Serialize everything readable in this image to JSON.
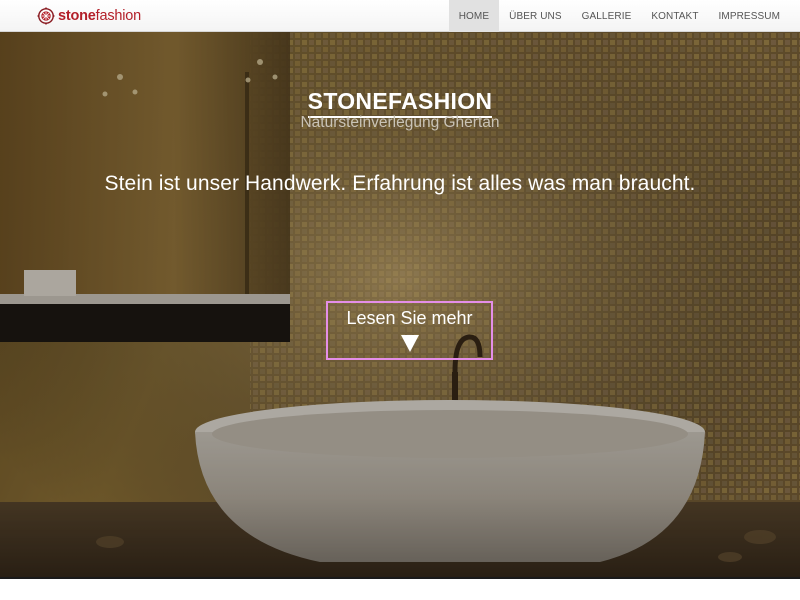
{
  "brand": {
    "bold": "stone",
    "light": "fashion",
    "icon": "brand-logo-icon",
    "color": "#b3202a"
  },
  "nav": {
    "items": [
      {
        "label": "HOME",
        "active": true
      },
      {
        "label": "ÜBER UNS",
        "active": false
      },
      {
        "label": "GALLERIE",
        "active": false
      },
      {
        "label": "KONTAKT",
        "active": false
      },
      {
        "label": "IMPRESSUM",
        "active": false
      }
    ]
  },
  "hero": {
    "title": "STONEFASHION",
    "subtitle": "Natursteinverlegung Ghertan",
    "tagline": "Stein ist unser Handwerk. Erfahrung ist alles was man braucht.",
    "more_label": "Lesen Sie mehr",
    "more_icon": "down-arrow-icon",
    "highlight_color": "#e48ee8"
  }
}
